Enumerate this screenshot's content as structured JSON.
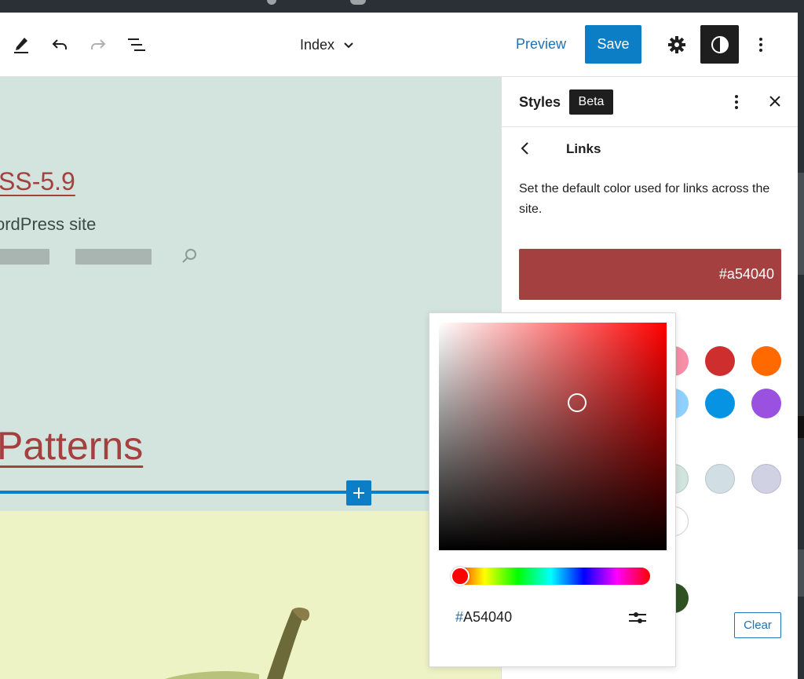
{
  "toolbar": {
    "document_title": "Index",
    "preview_label": "Preview",
    "save_label": "Save"
  },
  "canvas": {
    "site_title": "SS-5.9",
    "tagline": "ordPress site",
    "patterns_heading": "Patterns"
  },
  "sidebar": {
    "title": "Styles",
    "badge": "Beta",
    "section_title": "Links",
    "description": "Set the default color used for links across the site.",
    "current_color_label": "#a54040",
    "clear_label": "Clear"
  },
  "color_picker": {
    "hex_prefix": "#",
    "hex_value": "A54040"
  },
  "colors": {
    "accent": "#0c7ec5",
    "link_color": "#a54040",
    "palette": [
      "#f78da7",
      "#cf2e2e",
      "#ff6900",
      "#8ed1fc",
      "#0693e3",
      "#9b51e0",
      "#d1e4dd",
      "#d1dfe4",
      "#d1d1e4",
      "#ffffff",
      "#2f5223"
    ]
  },
  "icons": [
    "pencil-icon",
    "undo-icon",
    "redo-icon",
    "list-view-icon",
    "chevron-down-icon",
    "gear-icon",
    "half-circle-icon",
    "more-vertical-icon",
    "close-icon",
    "chevron-left-icon",
    "search-icon",
    "plus-icon",
    "sliders-icon"
  ]
}
